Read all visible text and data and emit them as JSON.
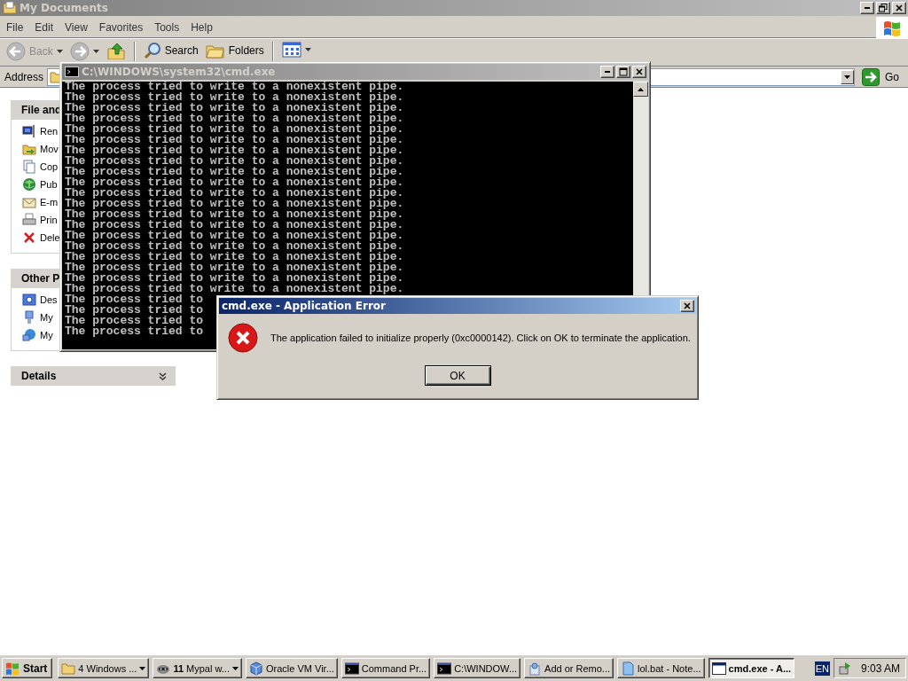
{
  "explorer": {
    "title": "My Documents",
    "active": false,
    "menu": [
      "File",
      "Edit",
      "View",
      "Favorites",
      "Tools",
      "Help"
    ],
    "toolbar": {
      "back": {
        "label": "Back",
        "disabled": true
      },
      "search": "Search",
      "folders": "Folders"
    },
    "address": {
      "label": "Address",
      "go": "Go"
    },
    "task_panes": [
      {
        "title": "File and",
        "items": [
          {
            "kind": "rename",
            "label": "Ren"
          },
          {
            "kind": "move",
            "label": "Mov"
          },
          {
            "kind": "copy",
            "label": "Cop"
          },
          {
            "kind": "publish",
            "label": "Pub"
          },
          {
            "kind": "email",
            "label": "E-m"
          },
          {
            "kind": "print",
            "label": "Prin"
          },
          {
            "kind": "delete",
            "label": "Dele"
          }
        ]
      },
      {
        "title": "Other P",
        "items": [
          {
            "kind": "desktop",
            "label": "Des"
          },
          {
            "kind": "documents",
            "label": "My"
          },
          {
            "kind": "network",
            "label": "My"
          }
        ]
      },
      {
        "title": "Details",
        "collapsed": true
      }
    ]
  },
  "console": {
    "title": "C:\\WINDOWS\\system32\\cmd.exe",
    "active": false,
    "lines": [
      "The process tried to write to a nonexistent pipe.",
      "The process tried to write to a nonexistent pipe.",
      "The process tried to write to a nonexistent pipe.",
      "The process tried to write to a nonexistent pipe.",
      "The process tried to write to a nonexistent pipe.",
      "The process tried to write to a nonexistent pipe.",
      "The process tried to write to a nonexistent pipe.",
      "The process tried to write to a nonexistent pipe.",
      "The process tried to write to a nonexistent pipe.",
      "The process tried to write to a nonexistent pipe.",
      "The process tried to write to a nonexistent pipe.",
      "The process tried to write to a nonexistent pipe.",
      "The process tried to write to a nonexistent pipe.",
      "The process tried to write to a nonexistent pipe.",
      "The process tried to write to a nonexistent pipe.",
      "The process tried to write to a nonexistent pipe.",
      "The process tried to write to a nonexistent pipe.",
      "The process tried to write to a nonexistent pipe.",
      "The process tried to write to a nonexistent pipe.",
      "The process tried to write to a nonexistent pipe.",
      "The process tried to",
      "The process tried to",
      "The process tried to",
      "The process tried to"
    ]
  },
  "dialog": {
    "title": "cmd.exe - Application Error",
    "active": true,
    "message": "The application failed to initialize properly (0xc0000142). Click on OK to terminate the application.",
    "button": "OK"
  },
  "taskbar": {
    "start": "Start",
    "buttons": [
      {
        "kind": "folder",
        "label": "4 Windows ...",
        "group": true,
        "selected": false
      },
      {
        "kind": "raccoon",
        "label": "**11** Mypal w...",
        "group": true,
        "selected": false
      },
      {
        "kind": "cube",
        "label": "Oracle VM Vir...",
        "group": false,
        "selected": false
      },
      {
        "kind": "console",
        "label": "Command Pr...",
        "group": false,
        "selected": false
      },
      {
        "kind": "console",
        "label": "C:\\WINDOW...",
        "group": false,
        "selected": false
      },
      {
        "kind": "installer",
        "label": "Add or Remo...",
        "group": false,
        "selected": false
      },
      {
        "kind": "notepad",
        "label": "lol.bat - Note...",
        "group": false,
        "selected": false
      },
      {
        "kind": "window",
        "label": "cmd.exe - A...",
        "group": false,
        "selected": true
      }
    ],
    "language": "EN",
    "clock": "9:03 AM"
  }
}
